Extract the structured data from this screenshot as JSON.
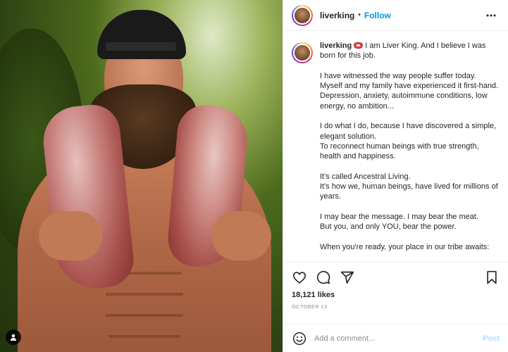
{
  "post": {
    "username": "liverking",
    "follow_label": "Follow",
    "header_separator": "•",
    "caption": {
      "username": "liverking",
      "text": "I am Liver King. And I believe I was born for this job.\n\nI have witnessed the way people suffer today. Myself and my family have experienced it first-hand. Depression, anxiety, autoimmune conditions, low energy, no ambition...\n\nI do what I do, because I have discovered a simple, elegant solution.\nTo reconnect human beings with true strength, health and happiness.\n\nIt's called Ancestral Living.\nIt's how we, human beings, have lived for millions of years.\n\nI may bear the message. I may bear the meat.\nBut you, and only YOU, bear the power.\n\nWhen you're ready, your place in our tribe awaits:"
    },
    "likes": "18,121 likes",
    "date": "OCTOBER 13",
    "comment": {
      "placeholder": "Add a comment...",
      "post_label": "Post"
    },
    "icons": {
      "more": "more-options-icon",
      "like": "heart-icon",
      "comment": "comment-icon",
      "share": "share-icon",
      "save": "bookmark-icon",
      "emoji": "emoji-icon",
      "user_tag": "user-tag-icon",
      "caption_emoji": "meat-emoji"
    },
    "colors": {
      "accent": "#0095f6",
      "post_disabled": "#b3dbff",
      "muted": "#8e8e8e",
      "text": "#262626"
    }
  }
}
